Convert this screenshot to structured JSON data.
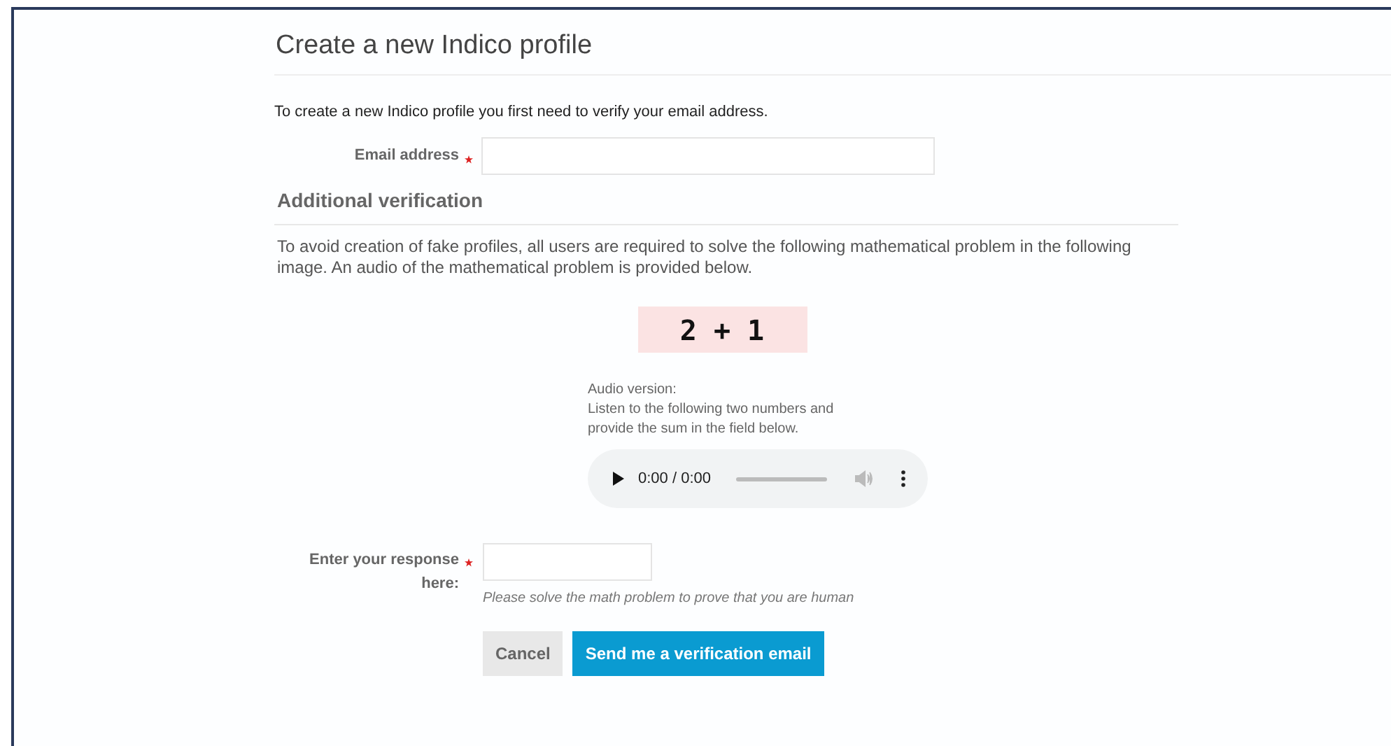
{
  "page": {
    "title": "Create a new Indico profile",
    "intro": "To create a new Indico profile you first need to verify your email address."
  },
  "email_field": {
    "label": "Email address",
    "required": true
  },
  "verification": {
    "heading": "Additional verification",
    "description": "To avoid creation of fake profiles, all users are required to solve the following mathematical problem in the following image. An audio of the mathematical problem is provided below.",
    "captcha_text": "2 + 1",
    "audio": {
      "label": "Audio version:",
      "instructions": "Listen to the following two numbers and provide the sum in the field below.",
      "time": "0:00 / 0:00"
    }
  },
  "response_field": {
    "label": "Enter your response here:",
    "required": true,
    "hint": "Please solve the math problem to prove that you are human"
  },
  "buttons": [
    {
      "label": "Cancel",
      "kind": "secondary"
    },
    {
      "label": "Send me a verification email",
      "kind": "primary"
    }
  ]
}
